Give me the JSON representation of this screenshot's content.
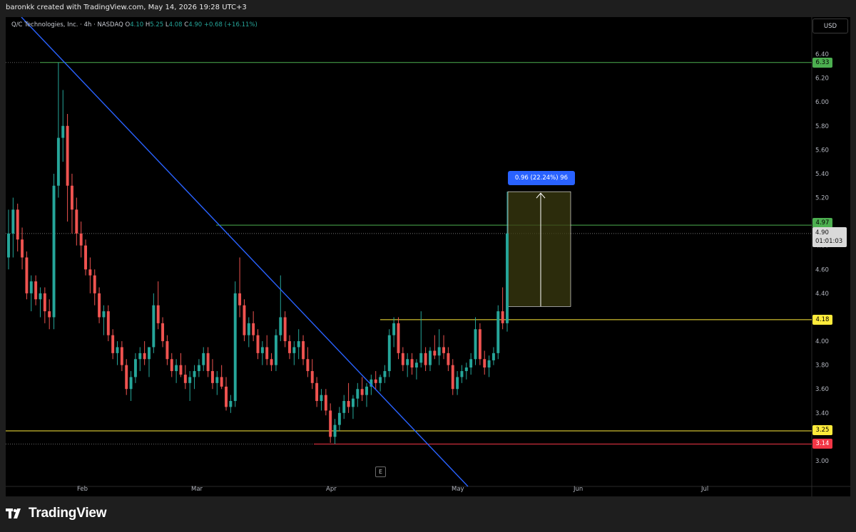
{
  "header": {
    "attribution": "baronkk created with TradingView.com, May 14, 2026 19:28 UTC+3"
  },
  "legend": {
    "symbol": "Q/C Technologies, Inc. · 4h · NASDAQ",
    "open_label": "O",
    "open": "4.10",
    "high_label": "H",
    "high": "5.25",
    "low_label": "L",
    "low": "4.08",
    "close_label": "C",
    "close": "4.90",
    "change": "+0.68 (+16.11%)"
  },
  "currency_button": "USD",
  "y_axis_ticks": [
    "6.40",
    "6.20",
    "6.00",
    "5.80",
    "5.60",
    "5.40",
    "5.20",
    "4.80",
    "4.60",
    "4.40",
    "4.00",
    "3.80",
    "3.60",
    "3.40",
    "3.00"
  ],
  "x_axis_ticks": [
    "Feb",
    "Mar",
    "Apr",
    "May",
    "Jun",
    "Jul"
  ],
  "price_labels": {
    "high_line": "6.33",
    "resistance": "4.97",
    "current_price": "4.90",
    "countdown": "01:01:03",
    "breakout": "4.18",
    "support": "3.25",
    "low_line": "3.14"
  },
  "measure_tool": {
    "label": "0.96 (22.24%) 96"
  },
  "earnings_badge": "E",
  "footer": {
    "brand": "TradingView"
  },
  "colors": {
    "up": "#26a69a",
    "down": "#ef5350",
    "trendline": "#2962ff",
    "green_line": "#4caf50",
    "yellow_line": "#ffeb3b",
    "red_line": "#f23645",
    "measure_fill": "#3b3b10"
  },
  "chart_data": {
    "type": "candlestick",
    "timeframe": "4h",
    "ylim": [
      2.88,
      6.55
    ],
    "x_ticks": [
      "Feb",
      "Mar",
      "Apr",
      "May",
      "Jun",
      "Jul"
    ],
    "candles": [
      [
        4.7,
        5.1,
        4.6,
        4.9
      ],
      [
        4.9,
        5.2,
        4.7,
        5.1
      ],
      [
        5.1,
        5.15,
        4.75,
        4.85
      ],
      [
        4.85,
        4.95,
        4.6,
        4.7
      ],
      [
        4.7,
        4.75,
        4.35,
        4.4
      ],
      [
        4.4,
        4.55,
        4.25,
        4.5
      ],
      [
        4.5,
        4.55,
        4.3,
        4.35
      ],
      [
        4.35,
        4.45,
        4.2,
        4.4
      ],
      [
        4.4,
        4.45,
        4.15,
        4.25
      ],
      [
        4.25,
        4.35,
        4.1,
        4.2
      ],
      [
        4.2,
        5.4,
        4.1,
        5.3
      ],
      [
        5.3,
        6.33,
        5.2,
        5.7
      ],
      [
        5.7,
        6.1,
        5.5,
        5.8
      ],
      [
        5.8,
        5.9,
        5.0,
        5.3
      ],
      [
        5.3,
        5.4,
        4.9,
        5.1
      ],
      [
        5.1,
        5.2,
        4.8,
        4.9
      ],
      [
        4.9,
        5.0,
        4.7,
        4.8
      ],
      [
        4.8,
        4.85,
        4.55,
        4.6
      ],
      [
        4.6,
        4.7,
        4.4,
        4.55
      ],
      [
        4.55,
        4.6,
        4.3,
        4.4
      ],
      [
        4.4,
        4.45,
        4.15,
        4.2
      ],
      [
        4.2,
        4.3,
        4.05,
        4.25
      ],
      [
        4.25,
        4.3,
        4.0,
        4.05
      ],
      [
        4.05,
        4.1,
        3.85,
        3.9
      ],
      [
        3.9,
        4.0,
        3.8,
        3.95
      ],
      [
        3.95,
        4.0,
        3.75,
        3.8
      ],
      [
        3.8,
        3.85,
        3.55,
        3.6
      ],
      [
        3.6,
        3.75,
        3.5,
        3.7
      ],
      [
        3.7,
        3.9,
        3.65,
        3.85
      ],
      [
        3.85,
        3.95,
        3.75,
        3.9
      ],
      [
        3.9,
        4.0,
        3.8,
        3.85
      ],
      [
        3.85,
        3.95,
        3.7,
        3.95
      ],
      [
        3.95,
        4.4,
        3.9,
        4.3
      ],
      [
        4.3,
        4.5,
        4.1,
        4.15
      ],
      [
        4.15,
        4.2,
        3.95,
        4.0
      ],
      [
        4.0,
        4.05,
        3.8,
        3.85
      ],
      [
        3.85,
        3.9,
        3.7,
        3.75
      ],
      [
        3.75,
        3.85,
        3.65,
        3.8
      ],
      [
        3.8,
        3.9,
        3.7,
        3.72
      ],
      [
        3.72,
        3.8,
        3.6,
        3.65
      ],
      [
        3.65,
        3.75,
        3.5,
        3.7
      ],
      [
        3.7,
        3.8,
        3.6,
        3.75
      ],
      [
        3.75,
        3.85,
        3.7,
        3.8
      ],
      [
        3.8,
        3.95,
        3.75,
        3.9
      ],
      [
        3.9,
        3.95,
        3.7,
        3.75
      ],
      [
        3.75,
        3.85,
        3.6,
        3.65
      ],
      [
        3.65,
        3.75,
        3.55,
        3.7
      ],
      [
        3.7,
        3.8,
        3.6,
        3.62
      ],
      [
        3.62,
        3.7,
        3.42,
        3.45
      ],
      [
        3.45,
        3.55,
        3.4,
        3.5
      ],
      [
        3.5,
        4.5,
        3.45,
        4.4
      ],
      [
        4.4,
        4.7,
        4.2,
        4.3
      ],
      [
        4.3,
        4.35,
        4.0,
        4.05
      ],
      [
        4.05,
        4.2,
        3.95,
        4.15
      ],
      [
        4.15,
        4.25,
        4.0,
        4.05
      ],
      [
        4.05,
        4.1,
        3.85,
        3.9
      ],
      [
        3.9,
        4.0,
        3.8,
        3.95
      ],
      [
        3.95,
        4.05,
        3.8,
        3.85
      ],
      [
        3.85,
        3.9,
        3.75,
        3.8
      ],
      [
        3.8,
        4.1,
        3.75,
        4.05
      ],
      [
        4.05,
        4.55,
        4.0,
        4.2
      ],
      [
        4.2,
        4.25,
        3.95,
        4.0
      ],
      [
        4.0,
        4.05,
        3.85,
        3.9
      ],
      [
        3.9,
        4.0,
        3.8,
        3.95
      ],
      [
        3.95,
        4.1,
        3.85,
        4.0
      ],
      [
        4.0,
        4.05,
        3.8,
        3.85
      ],
      [
        3.85,
        3.95,
        3.7,
        3.75
      ],
      [
        3.75,
        3.85,
        3.6,
        3.65
      ],
      [
        3.65,
        3.7,
        3.45,
        3.5
      ],
      [
        3.5,
        3.6,
        3.42,
        3.55
      ],
      [
        3.55,
        3.6,
        3.38,
        3.42
      ],
      [
        3.42,
        3.48,
        3.15,
        3.2
      ],
      [
        3.2,
        3.35,
        3.14,
        3.3
      ],
      [
        3.3,
        3.45,
        3.25,
        3.4
      ],
      [
        3.4,
        3.55,
        3.35,
        3.5
      ],
      [
        3.5,
        3.65,
        3.4,
        3.45
      ],
      [
        3.45,
        3.55,
        3.35,
        3.52
      ],
      [
        3.52,
        3.65,
        3.45,
        3.6
      ],
      [
        3.6,
        3.7,
        3.5,
        3.55
      ],
      [
        3.55,
        3.65,
        3.45,
        3.62
      ],
      [
        3.62,
        3.72,
        3.55,
        3.68
      ],
      [
        3.68,
        3.75,
        3.6,
        3.65
      ],
      [
        3.65,
        3.72,
        3.58,
        3.7
      ],
      [
        3.7,
        3.8,
        3.65,
        3.75
      ],
      [
        3.75,
        4.1,
        3.7,
        4.05
      ],
      [
        4.05,
        4.2,
        3.95,
        4.15
      ],
      [
        4.15,
        4.2,
        3.85,
        3.9
      ],
      [
        3.9,
        3.95,
        3.75,
        3.8
      ],
      [
        3.8,
        3.9,
        3.7,
        3.85
      ],
      [
        3.85,
        3.9,
        3.72,
        3.78
      ],
      [
        3.78,
        3.85,
        3.68,
        3.82
      ],
      [
        3.82,
        4.25,
        3.78,
        3.9
      ],
      [
        3.9,
        3.95,
        3.75,
        3.8
      ],
      [
        3.8,
        3.95,
        3.75,
        3.92
      ],
      [
        3.92,
        4.05,
        3.85,
        3.88
      ],
      [
        3.88,
        4.1,
        3.8,
        3.95
      ],
      [
        3.95,
        4.05,
        3.85,
        3.9
      ],
      [
        3.9,
        3.95,
        3.75,
        3.8
      ],
      [
        3.8,
        3.85,
        3.55,
        3.6
      ],
      [
        3.6,
        3.75,
        3.55,
        3.7
      ],
      [
        3.7,
        3.8,
        3.65,
        3.75
      ],
      [
        3.75,
        3.82,
        3.68,
        3.78
      ],
      [
        3.78,
        3.9,
        3.72,
        3.85
      ],
      [
        3.85,
        4.2,
        3.8,
        4.1
      ],
      [
        4.1,
        4.15,
        3.8,
        3.85
      ],
      [
        3.85,
        3.92,
        3.72,
        3.78
      ],
      [
        3.78,
        3.88,
        3.7,
        3.84
      ],
      [
        3.84,
        3.95,
        3.8,
        3.9
      ],
      [
        3.9,
        4.3,
        3.85,
        4.25
      ],
      [
        4.25,
        4.45,
        4.1,
        4.15
      ],
      [
        4.15,
        5.25,
        4.08,
        4.9
      ]
    ]
  }
}
